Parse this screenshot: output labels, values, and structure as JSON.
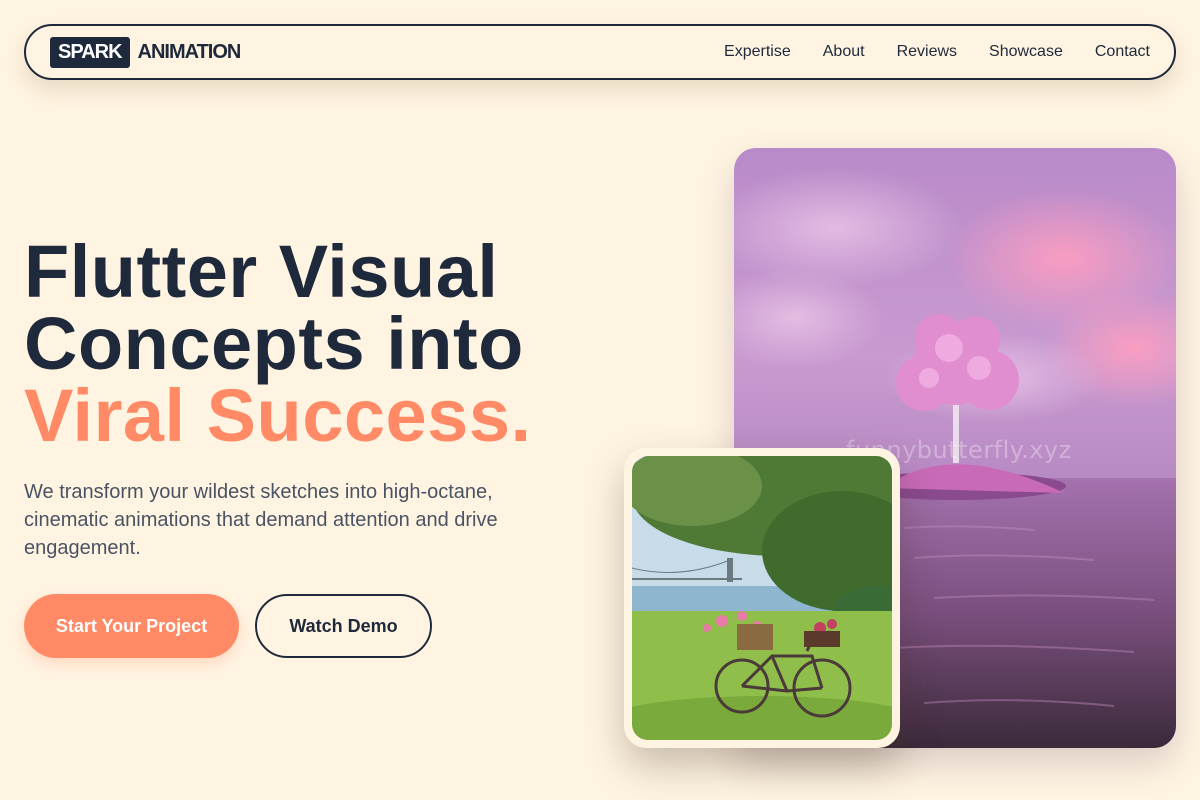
{
  "brand": {
    "badge": "SPARK",
    "name": "ANIMATION"
  },
  "nav": {
    "links": [
      "Expertise",
      "About",
      "Reviews",
      "Showcase",
      "Contact"
    ]
  },
  "hero": {
    "headline_line1": "Flutter Visual",
    "headline_line2": "Concepts into",
    "headline_accent": "Viral Success.",
    "subtext": "We transform your wildest sketches into high-octane, cinematic animations that demand attention and drive engagement.",
    "primary_button": "Start Your Project",
    "secondary_button": "Watch Demo"
  },
  "images": {
    "main_watermark": "funnybutterfly.xyz",
    "main_image_icon": "pink-tree-island-photo",
    "secondary_image_icon": "bicycle-by-river-photo"
  },
  "colors": {
    "background": "#fff4e2",
    "navy": "#1e293b",
    "accent": "#ff8a65",
    "body_text": "#4a5363"
  }
}
